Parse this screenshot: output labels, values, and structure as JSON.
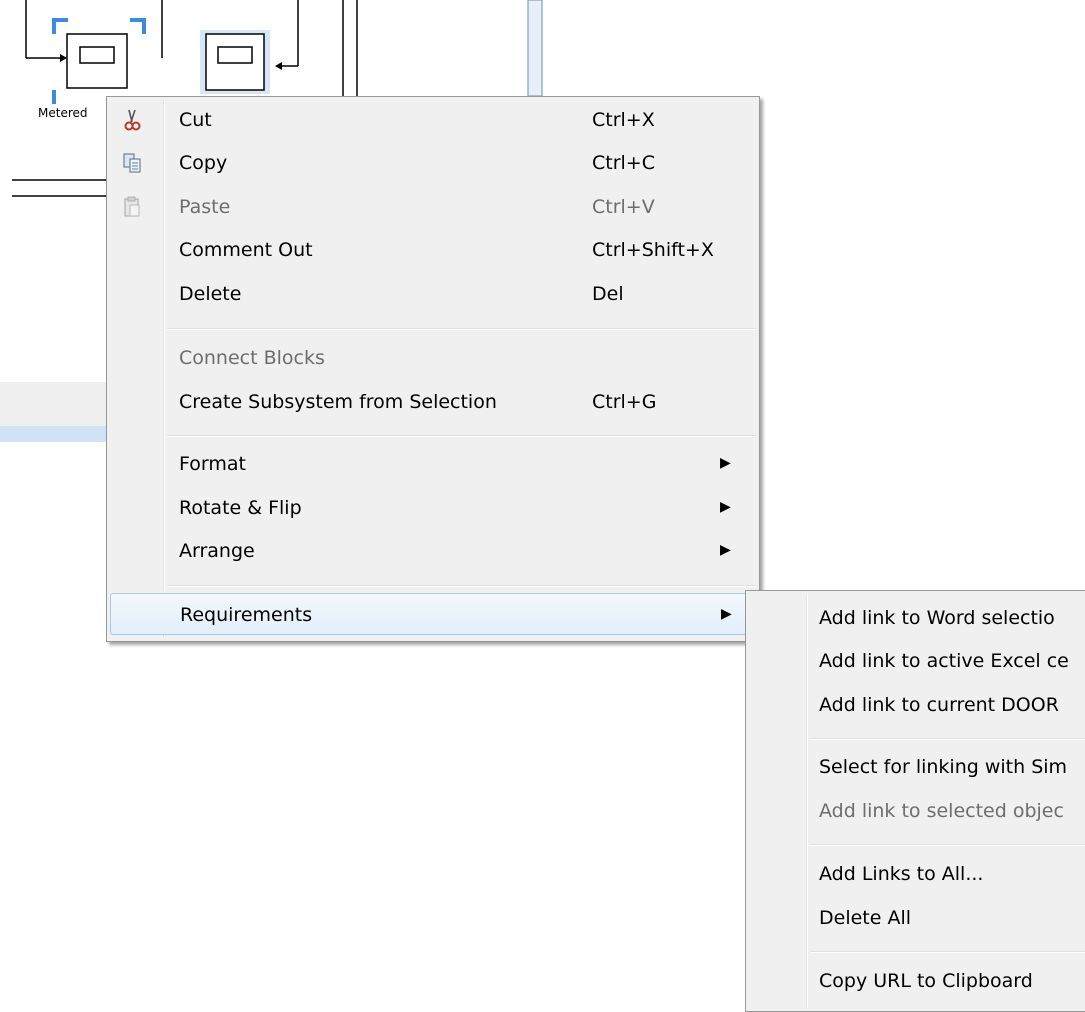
{
  "canvas": {
    "block_label": "Metered",
    "accent_color": "#3c8be3"
  },
  "context_menu": {
    "items": [
      {
        "label": "Cut",
        "shortcut": "Ctrl+X",
        "icon": "scissors-icon"
      },
      {
        "label": "Copy",
        "shortcut": "Ctrl+C",
        "icon": "copy-icon"
      },
      {
        "label": "Paste",
        "shortcut": "Ctrl+V",
        "icon": "paste-icon",
        "disabled": true
      },
      {
        "label": "Comment Out",
        "shortcut": "Ctrl+Shift+X"
      },
      {
        "label": "Delete",
        "shortcut": "Del"
      },
      {
        "label": "Connect Blocks",
        "disabled": true
      },
      {
        "label": "Create Subsystem from Selection",
        "shortcut": "Ctrl+G"
      },
      {
        "label": "Format",
        "submenu": true
      },
      {
        "label": "Rotate & Flip",
        "submenu": true
      },
      {
        "label": "Arrange",
        "submenu": true
      },
      {
        "label": "Requirements",
        "submenu": true,
        "highlighted": true
      }
    ]
  },
  "requirements_submenu": {
    "items": [
      {
        "label": "Add link to Word selectio"
      },
      {
        "label": "Add link to active Excel ce"
      },
      {
        "label": "Add link to current DOOR"
      },
      {
        "label": "Select for linking with Sim"
      },
      {
        "label": "Add link to selected objec",
        "disabled": true
      },
      {
        "label": "Add Links to All..."
      },
      {
        "label": "Delete All"
      },
      {
        "label": "Copy URL to Clipboard"
      }
    ]
  }
}
